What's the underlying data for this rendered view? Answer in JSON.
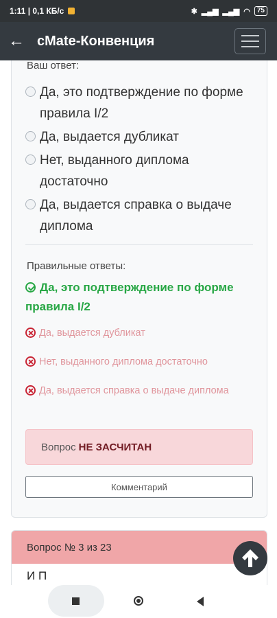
{
  "status_bar": {
    "time_speed": "1:11 | 0,1 КБ/с",
    "battery": "75"
  },
  "app_bar": {
    "title": "cMate-Конвенция"
  },
  "question": {
    "your_answer_label": "Ваш ответ:",
    "options": [
      "Да, это подтверждение по форме правила I/2",
      "Да, выдается дубликат",
      "Нет, выданного диплома достаточно",
      "Да, выдается справка о выдаче диплома"
    ],
    "correct_label": "Правильные ответы:",
    "correct_answer": "Да, это подтверждение по форме правила I/2",
    "wrong_answers": [
      "Да, выдается дубликат",
      "Нет, выданного диплома достаточно",
      "Да, выдается справка о выдаче диплома"
    ],
    "result_prefix": "Вопрос",
    "result_status": "НЕ ЗАСЧИТАН",
    "comment_button": "Комментарий"
  },
  "next_question": {
    "header": "Вопрос № 3 из 23",
    "body_preview": "И                    П"
  },
  "colors": {
    "correct": "#28a745",
    "wrong": "#c82333",
    "alert_bg": "#f8d7da",
    "appbar": "#343a40"
  }
}
